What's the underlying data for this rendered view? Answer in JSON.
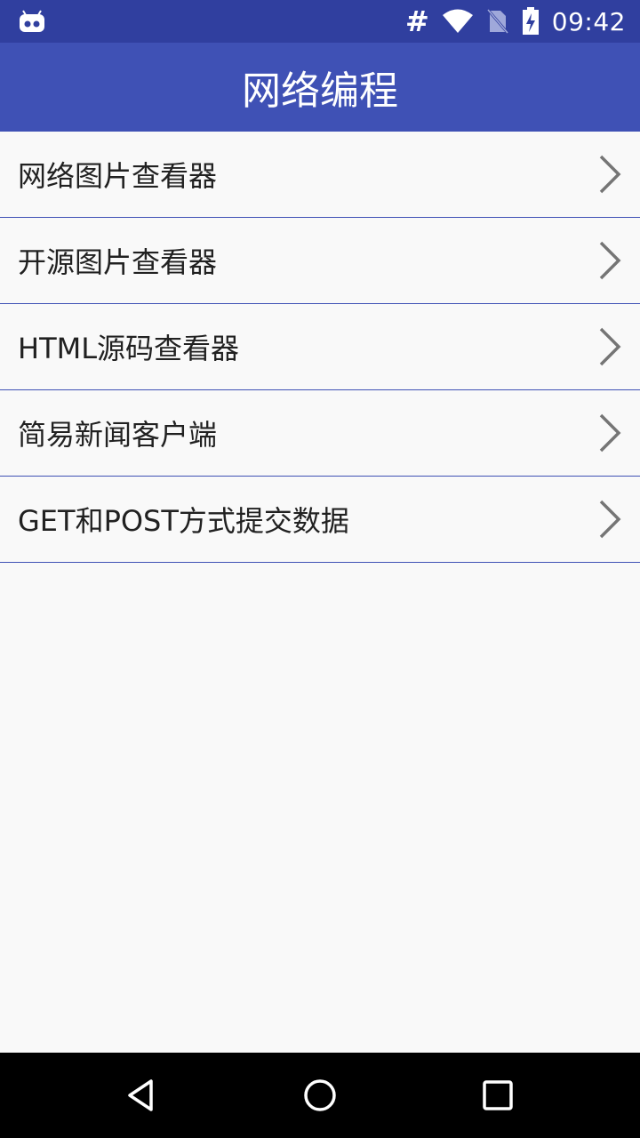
{
  "status_bar": {
    "time": "09:42",
    "hash_symbol": "#",
    "left_icon": "android-debug-icon",
    "icons": [
      "wifi-icon",
      "no-sim-icon",
      "battery-charging-icon"
    ]
  },
  "app_bar": {
    "title": "网络编程",
    "background_color": "#3f51b5"
  },
  "list": {
    "items": [
      {
        "label": "网络图片查看器"
      },
      {
        "label": "开源图片查看器"
      },
      {
        "label": "HTML源码查看器"
      },
      {
        "label": "简易新闻客户端"
      },
      {
        "label": "GET和POST方式提交数据"
      }
    ],
    "trailing_icon": "chevron-right-icon"
  },
  "nav_bar": {
    "buttons": [
      "back-icon",
      "home-icon",
      "recents-icon"
    ]
  }
}
